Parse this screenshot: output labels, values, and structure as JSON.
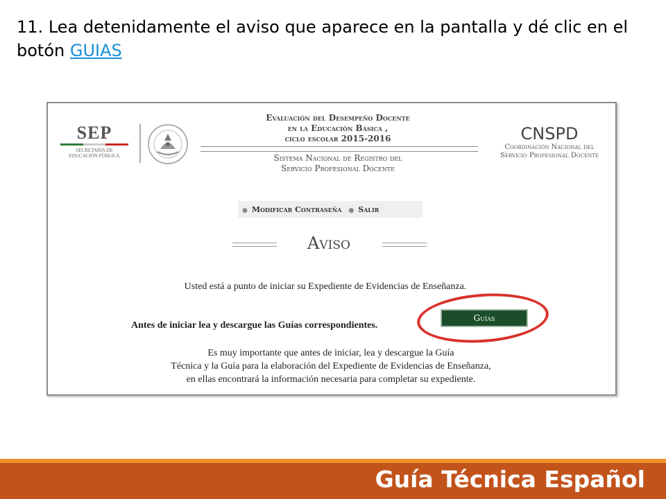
{
  "instruction": {
    "number": "11.",
    "text": "Lea detenidamente el aviso que aparece en la pantalla y dé clic en el botón",
    "link": "GUIAS",
    "link_color": "#1a8fd6"
  },
  "header": {
    "sep_logo": "SEP",
    "sep_sub_line1": "Secretaría de",
    "sep_sub_line2": "Educación Pública",
    "seal_icon": "mexican-coat-of-arms-seal",
    "title_line1": "Evaluación del Desempeño Docente",
    "title_line2": "en la Educación Básica ,",
    "title_line3": "ciclo escolar 2015-2016",
    "subtitle_line1": "Sistema Nacional de Registro del",
    "subtitle_line2": "Servicio Profesional Docente",
    "cnspd_logo": "CNSPD",
    "cnspd_sub_line1": "Coordinación Nacional del",
    "cnspd_sub_line2": "Servicio Profesional Docente"
  },
  "menu": {
    "items": [
      {
        "label": "Modificar Contraseña"
      },
      {
        "label": "Salir"
      }
    ]
  },
  "notice": {
    "title": "Aviso",
    "line1": "Usted está a punto de iniciar su Expediente de Evidencias de Enseñanza.",
    "line2": "Antes de iniciar lea y descargue las Guías correspondientes.",
    "button_label": "Guías",
    "button_color": "#1b4d2b",
    "highlight_color": "#d9322b",
    "para_line1": "Es muy importante que antes de iniciar, lea y descargue la Guía",
    "para_line2": "Técnica y la Guía para la elaboración del Expediente de Evidencias de Enseñanza,",
    "para_line3": "en ellas encontrará la información necesaria para completar su expediente."
  },
  "footer": {
    "title": "Guía Técnica Español",
    "bg_color": "#c2531b",
    "stripe_color": "#f0902a"
  }
}
